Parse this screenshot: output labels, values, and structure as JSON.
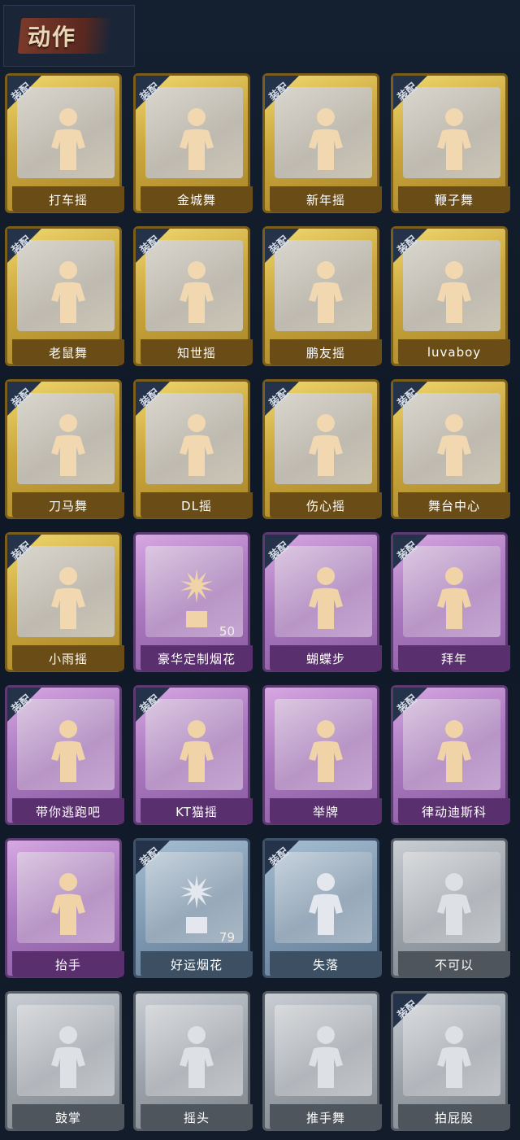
{
  "header": {
    "title": "动作"
  },
  "equip_label": "装配",
  "items": [
    {
      "name": "打车摇",
      "tier": "gold",
      "equipped": true,
      "icon": "dance-pose-icon"
    },
    {
      "name": "金城舞",
      "tier": "gold",
      "equipped": true,
      "icon": "dance-pose-icon"
    },
    {
      "name": "新年摇",
      "tier": "gold",
      "equipped": true,
      "icon": "dance-pose-icon"
    },
    {
      "name": "鞭子舞",
      "tier": "gold",
      "equipped": true,
      "icon": "dance-pose-icon"
    },
    {
      "name": "老鼠舞",
      "tier": "gold",
      "equipped": true,
      "icon": "dance-pose-icon"
    },
    {
      "name": "知世摇",
      "tier": "gold",
      "equipped": true,
      "icon": "dance-pose-icon"
    },
    {
      "name": "鹏友摇",
      "tier": "gold",
      "equipped": true,
      "icon": "dance-pose-icon"
    },
    {
      "name": "luvaboy",
      "tier": "gold",
      "equipped": true,
      "icon": "dance-pose-icon"
    },
    {
      "name": "刀马舞",
      "tier": "gold",
      "equipped": true,
      "icon": "dance-pose-icon"
    },
    {
      "name": "DL摇",
      "tier": "gold",
      "equipped": true,
      "icon": "dance-pose-icon"
    },
    {
      "name": "伤心摇",
      "tier": "gold",
      "equipped": true,
      "icon": "heart-hands-icon"
    },
    {
      "name": "舞台中心",
      "tier": "gold",
      "equipped": true,
      "icon": "dance-pose-icon"
    },
    {
      "name": "小雨摇",
      "tier": "gold",
      "equipped": true,
      "icon": "dance-pose-icon"
    },
    {
      "name": "豪华定制烟花",
      "tier": "purple",
      "equipped": false,
      "icon": "fireworks-icon",
      "count": "50"
    },
    {
      "name": "蝴蝶步",
      "tier": "purple",
      "equipped": true,
      "icon": "dance-pose-icon"
    },
    {
      "name": "拜年",
      "tier": "purple",
      "equipped": true,
      "icon": "bow-greeting-icon"
    },
    {
      "name": "带你逃跑吧",
      "tier": "purple",
      "equipped": true,
      "icon": "dance-pose-icon"
    },
    {
      "name": "KT猫摇",
      "tier": "purple",
      "equipped": true,
      "icon": "dance-pose-icon"
    },
    {
      "name": "举牌",
      "tier": "purple",
      "equipped": false,
      "icon": "hold-sign-icon"
    },
    {
      "name": "律动迪斯科",
      "tier": "purple",
      "equipped": true,
      "icon": "disco-pose-icon"
    },
    {
      "name": "抬手",
      "tier": "purple",
      "equipped": false,
      "icon": "raise-hand-icon"
    },
    {
      "name": "好运烟花",
      "tier": "blue",
      "equipped": true,
      "icon": "firecracker-icon",
      "count": "79"
    },
    {
      "name": "失落",
      "tier": "blue",
      "equipped": true,
      "icon": "crawl-pose-icon"
    },
    {
      "name": "不可以",
      "tier": "grey",
      "equipped": false,
      "icon": "finger-wag-icon"
    },
    {
      "name": "鼓掌",
      "tier": "grey",
      "equipped": false,
      "icon": "clap-hands-icon"
    },
    {
      "name": "摇头",
      "tier": "grey",
      "equipped": false,
      "icon": "dance-pose-icon"
    },
    {
      "name": "推手舞",
      "tier": "grey",
      "equipped": false,
      "icon": "dance-pose-icon"
    },
    {
      "name": "拍屁股",
      "tier": "grey",
      "equipped": true,
      "icon": "dance-pose-icon"
    }
  ]
}
